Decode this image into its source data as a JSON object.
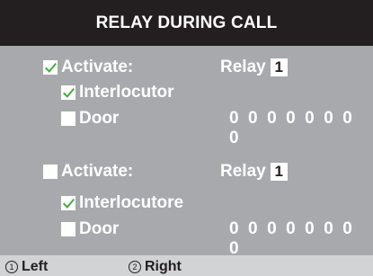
{
  "title": "RELAY DURING CALL",
  "block1": {
    "activate_label": "Activate:",
    "activate_checked": true,
    "relay_label": "Relay",
    "relay_number": "1",
    "interlocutor_label": "Interlocutor",
    "interlocutor_checked": true,
    "door_label": "Door",
    "door_checked": false,
    "door_code": "0 0 0 0 0 0 0 0"
  },
  "block2": {
    "activate_label": "Activate:",
    "activate_checked": false,
    "relay_label": "Relay",
    "relay_number": "1",
    "interlocutor_label": "Interlocutore",
    "interlocutor_checked": true,
    "door_label": "Door",
    "door_checked": false,
    "door_code": "0 0 0 0 0 0 0 0"
  },
  "footer": {
    "left_number": "1",
    "left_label": "Left",
    "right_number": "2",
    "right_label": "Right"
  },
  "colors": {
    "background": "#a7a9ac",
    "title_bar": "#231f20",
    "check_green": "#3aa935",
    "footer_bar": "#d1d3d4"
  }
}
